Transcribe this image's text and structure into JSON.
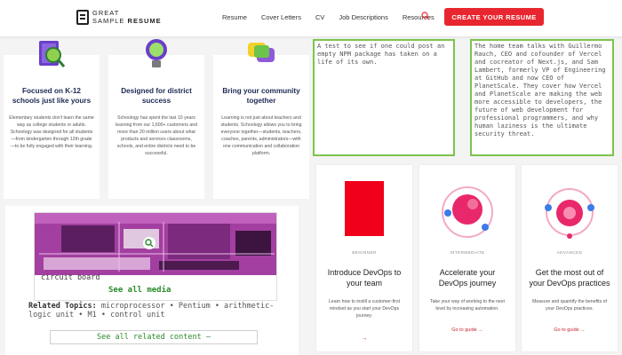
{
  "header": {
    "logo_line1": "GREAT",
    "logo_line2a": "SAMPLE",
    "logo_line2b": "RESUME",
    "nav": [
      "Resume",
      "Cover Letters",
      "CV",
      "Job Descriptions",
      "Resources"
    ],
    "cta": "CREATE YOUR RESUME"
  },
  "features": [
    {
      "title": "Focused on K-12 schools just like yours",
      "body": "Elementary students don't learn the same way as college students or adults. Schoology was designed for all students—from kindergarten through 12th grade—to be fully engaged with their learning."
    },
    {
      "title": "Designed for district success",
      "body": "Schoology has spent the last 10 years learning from our 1,600+ customers and more than 20 million users about what products and services classrooms, schools, and entire districts need to be successful."
    },
    {
      "title": "Bring your community together",
      "body": "Learning is not just about teachers and students. Schoology allows you to bring everyone together—students, teachers, coaches, parents, administrators—with one communication and collaboration platform."
    }
  ],
  "textboxes": [
    "A test to see if one could post an empty NPM package has taken on a life of its own.",
    "The home team talks with Guillermo Rauch, CEO and cofounder of Vercel and cocreator of Next.js, and Sam Lambert, formerly VP of Engineering at GitHub and now CEO of PlanetScale. They cover how Vercel and PlanetScale are making the web more accessible to developers, the future of web development for professional programmers, and why human laziness is the ultimate security threat."
  ],
  "media": {
    "caption": "circuit board",
    "see_all_media": "See all media",
    "related_label": "Related Topics:",
    "related_topics": "microprocessor • Pentium • arithmetic-logic unit • M1 • control unit",
    "see_all_related": "See all related content —"
  },
  "devops": [
    {
      "tag": "BEGINNER",
      "title": "Introduce DevOps to your team",
      "body": "Learn how to instill a customer-first mindset as you start your DevOps journey.",
      "link": "→"
    },
    {
      "tag": "INTERMEDIATE",
      "title": "Accelerate your DevOps journey",
      "body": "Take your way of working to the next level by increasing automation.",
      "link": "Go to guide →"
    },
    {
      "tag": "ADVANCED",
      "title": "Get the most out of your DevOps practices",
      "body": "Measure and quantify the benefits of your DevOps practices.",
      "link": "Go to guide →"
    }
  ],
  "colors": {
    "accent": "#e8262f",
    "title_navy": "#1e2a55",
    "link_green": "#2a8a2a",
    "box_border": "#7cc44e"
  }
}
